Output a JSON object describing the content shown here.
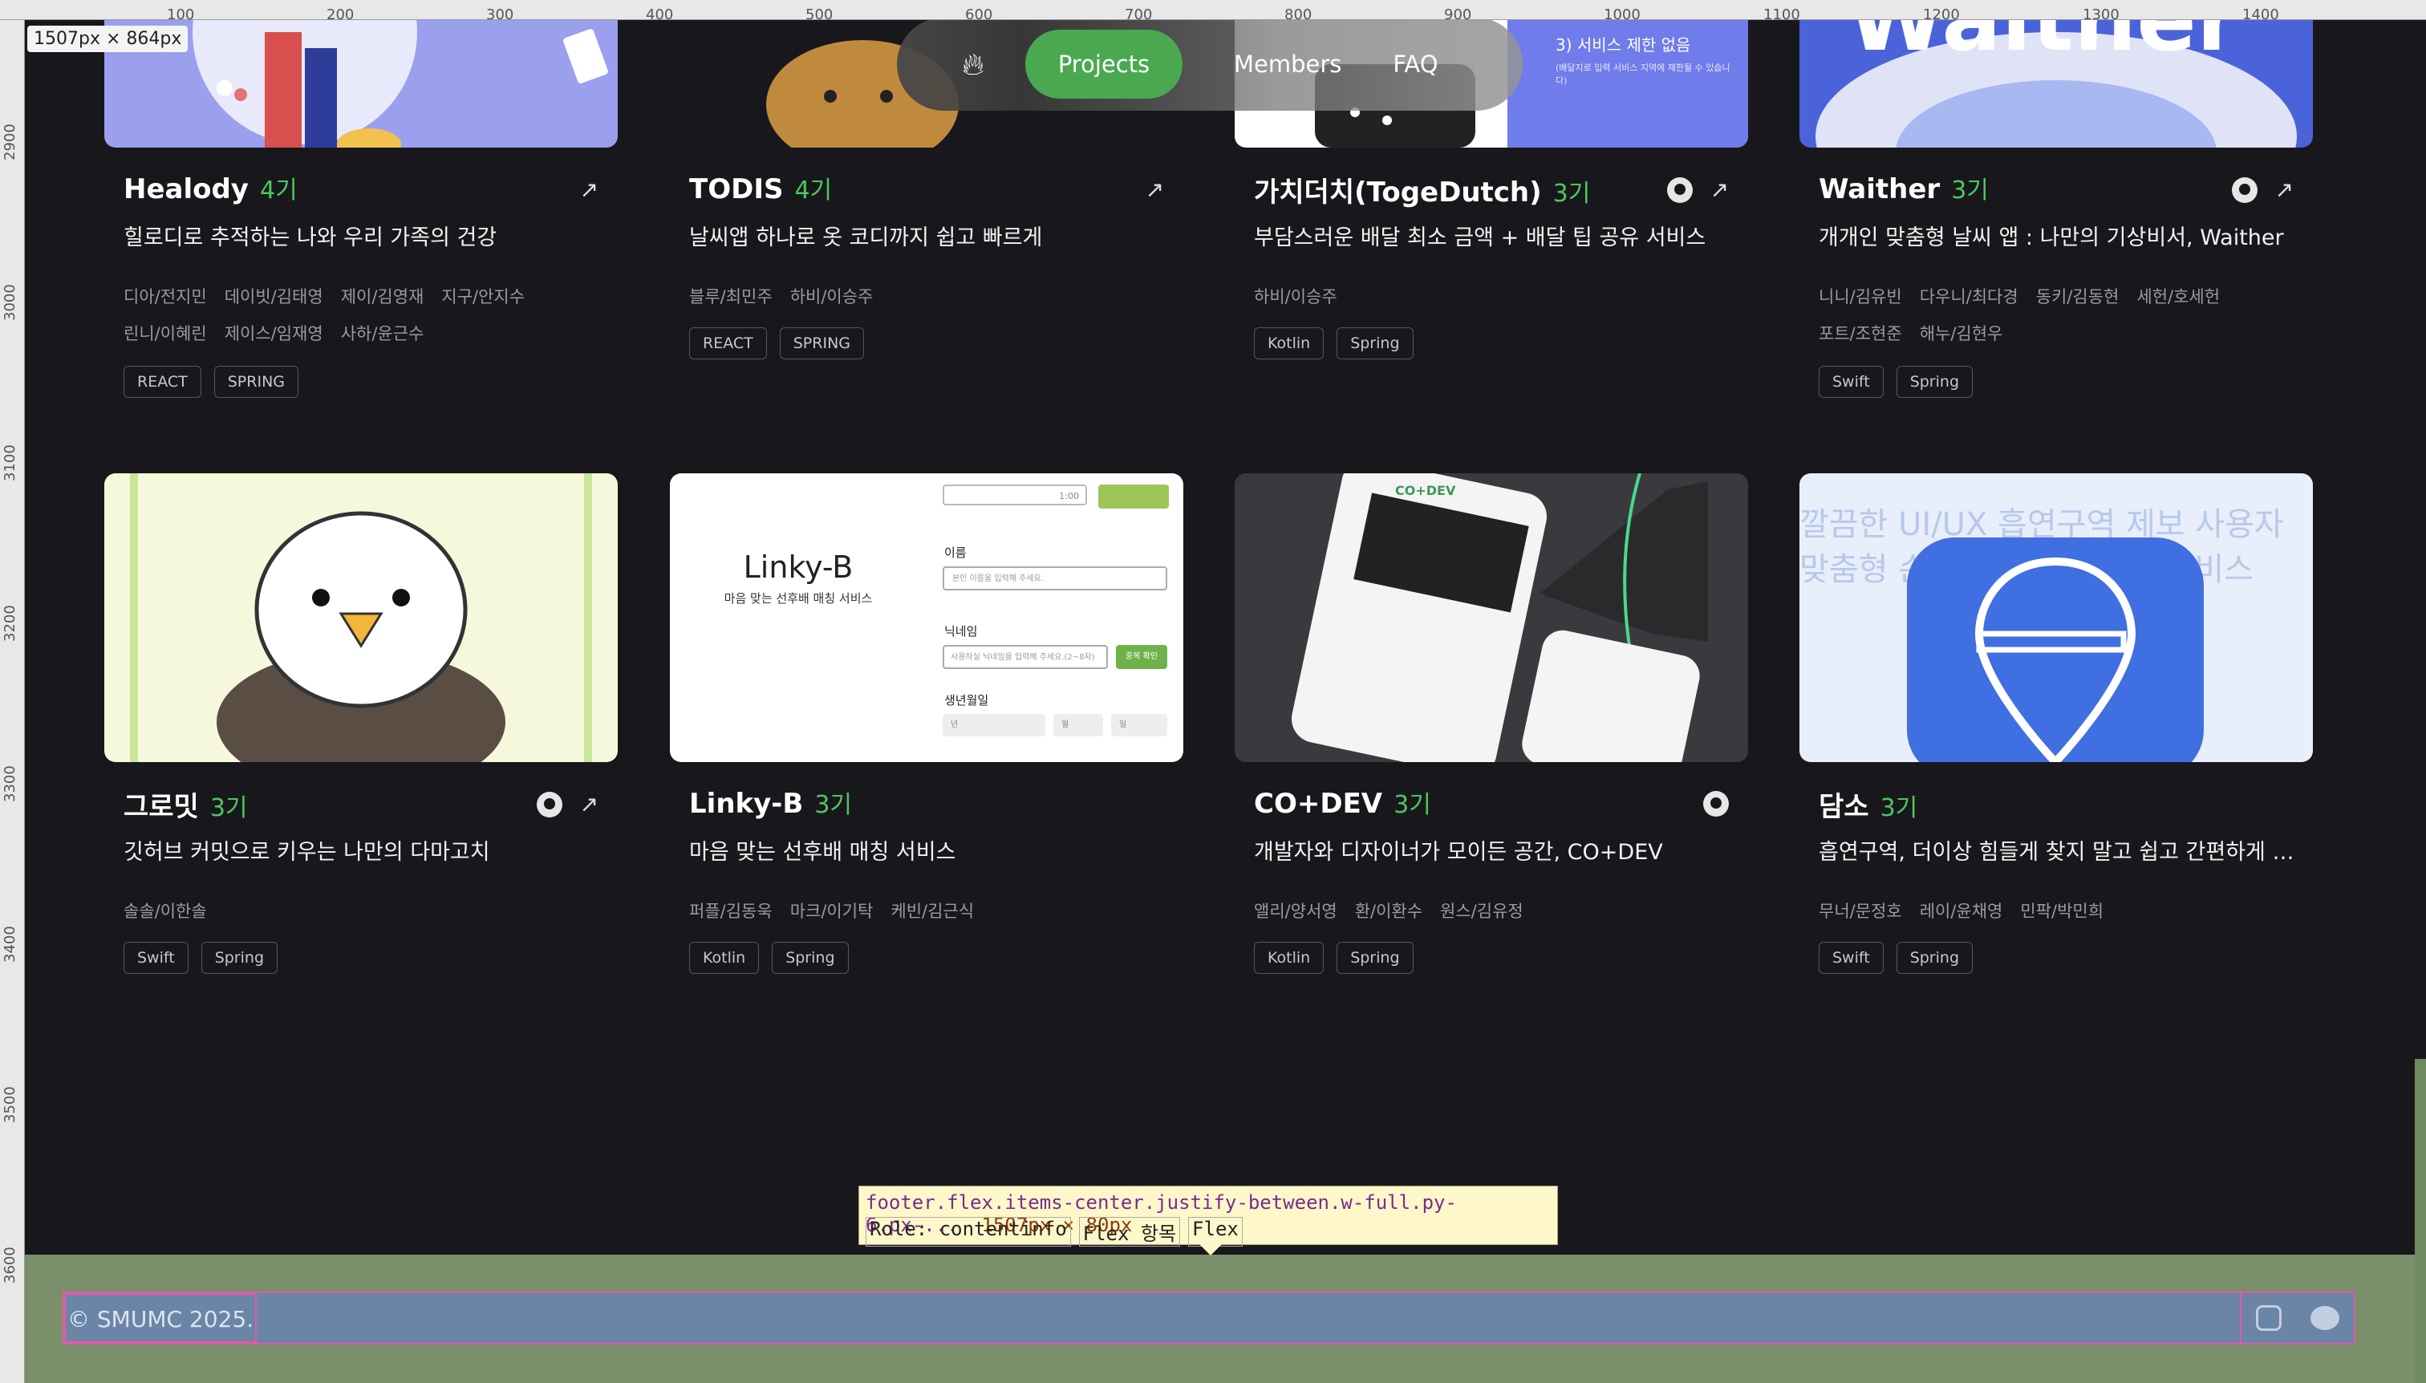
{
  "inspector": {
    "dims_badge": "1507px × 864px",
    "ruler_top": [
      "100",
      "200",
      "300",
      "400",
      "500",
      "600",
      "700",
      "800",
      "900",
      "1000",
      "1100",
      "1200",
      "1300",
      "1400"
    ],
    "ruler_left": [
      "2900",
      "3000",
      "3100",
      "3200",
      "3300",
      "3400",
      "3500",
      "3600"
    ],
    "tooltip_selector": "footer.flex.items-center.justify-between.w-full.py-6.px-...",
    "tooltip_size": "1507px × 80px",
    "tooltip_role": "Role: contentinfo",
    "tooltip_flex_item": "Flex 항목",
    "tooltip_flex": "Flex"
  },
  "nav": {
    "logo_icon": "flame-icon",
    "items": [
      "Projects",
      "Members",
      "FAQ"
    ],
    "active": "Projects"
  },
  "projects": [
    {
      "title": "Healody",
      "gen": "4기",
      "desc": "힐로디로 추적하는 나와 우리 가족의 건강",
      "members": [
        "디아/전지민",
        "데이빗/김태영",
        "제이/김영재",
        "지구/안지수",
        "린니/이혜린",
        "제이스/임재영",
        "사하/윤근수"
      ],
      "tags": [
        "REACT",
        "SPRING"
      ],
      "github": false,
      "link": true
    },
    {
      "title": "TODIS",
      "gen": "4기",
      "desc": "날씨앱 하나로 옷 코디까지 쉽고 빠르게",
      "members": [
        "블루/최민주",
        "하비/이승주"
      ],
      "tags": [
        "REACT",
        "SPRING"
      ],
      "github": false,
      "link": true
    },
    {
      "title": "가치더치(TogeDutch)",
      "gen": "3기",
      "desc": "부담스러운 배달 최소 금액 + 배달 팁 공유 서비스",
      "members": [
        "하비/이승주"
      ],
      "tags": [
        "Kotlin",
        "Spring"
      ],
      "github": true,
      "link": true
    },
    {
      "title": "Waither",
      "gen": "3기",
      "desc": "개개인 맞춤형 날씨 앱 : 나만의 기상비서, Waither",
      "members": [
        "니니/김유빈",
        "다우니/최다경",
        "동키/김동현",
        "세헌/호세헌",
        "포트/조현준",
        "해누/김현우"
      ],
      "tags": [
        "Swift",
        "Spring"
      ],
      "github": true,
      "link": true
    },
    {
      "title": "그로밋",
      "gen": "3기",
      "desc": "깃허브 커밋으로 키우는 나만의 다마고치",
      "members": [
        "솔솔/이한솔"
      ],
      "tags": [
        "Swift",
        "Spring"
      ],
      "github": true,
      "link": true
    },
    {
      "title": "Linky-B",
      "gen": "3기",
      "desc": "마음 맞는 선후배 매칭 서비스",
      "members": [
        "퍼플/김동욱",
        "마크/이기탁",
        "케빈/김근식"
      ],
      "tags": [
        "Kotlin",
        "Spring"
      ],
      "github": false,
      "link": false
    },
    {
      "title": "CO+DEV",
      "gen": "3기",
      "desc": "개발자와 디자이너가 모이든 공간, CO+DEV",
      "members": [
        "앨리/양서영",
        "환/이환수",
        "원스/김유정"
      ],
      "tags": [
        "Kotlin",
        "Spring"
      ],
      "github": true,
      "link": false
    },
    {
      "title": "담소",
      "gen": "3기",
      "desc": "흡연구역, 더이상 힘들게 찾지 말고 쉽고 간편하게 …",
      "members": [
        "무너/문정호",
        "레이/윤채영",
        "민팍/박민희"
      ],
      "tags": [
        "Swift",
        "Spring"
      ],
      "github": false,
      "link": false
    }
  ],
  "thumbs": {
    "waither_text": "Waither",
    "togedutch_text": "3) 서비스 제한 없음",
    "togedutch_sub": "(배달지로 입력 서비스 지역에 제한될 수 있습니다)",
    "linky_name": "Linky-B",
    "linky_sub": "마음 맞는 선후배 매칭 서비스",
    "linky_form": [
      "이름",
      "닉네임",
      "생년월일"
    ],
    "linky_ph1": "본인 이름을 입력해 주세요.",
    "linky_ph2": "사용하실 닉네임을 입력해 주세요.(2~8자)",
    "linky_btn": "중복 확인",
    "linky_time": "1:00",
    "linky_sel": [
      "년",
      "월",
      "일"
    ],
    "codev_brand": "CO+DEV",
    "damso_words": "깔끔한 UI/UX 흡연구역 제보 사용자 맞춤형 손쉬운 직관적 위한 서비스"
  },
  "footer": {
    "copyright": "© SMUMC 2025.",
    "icons": [
      "instagram-icon",
      "chat-icon"
    ]
  }
}
